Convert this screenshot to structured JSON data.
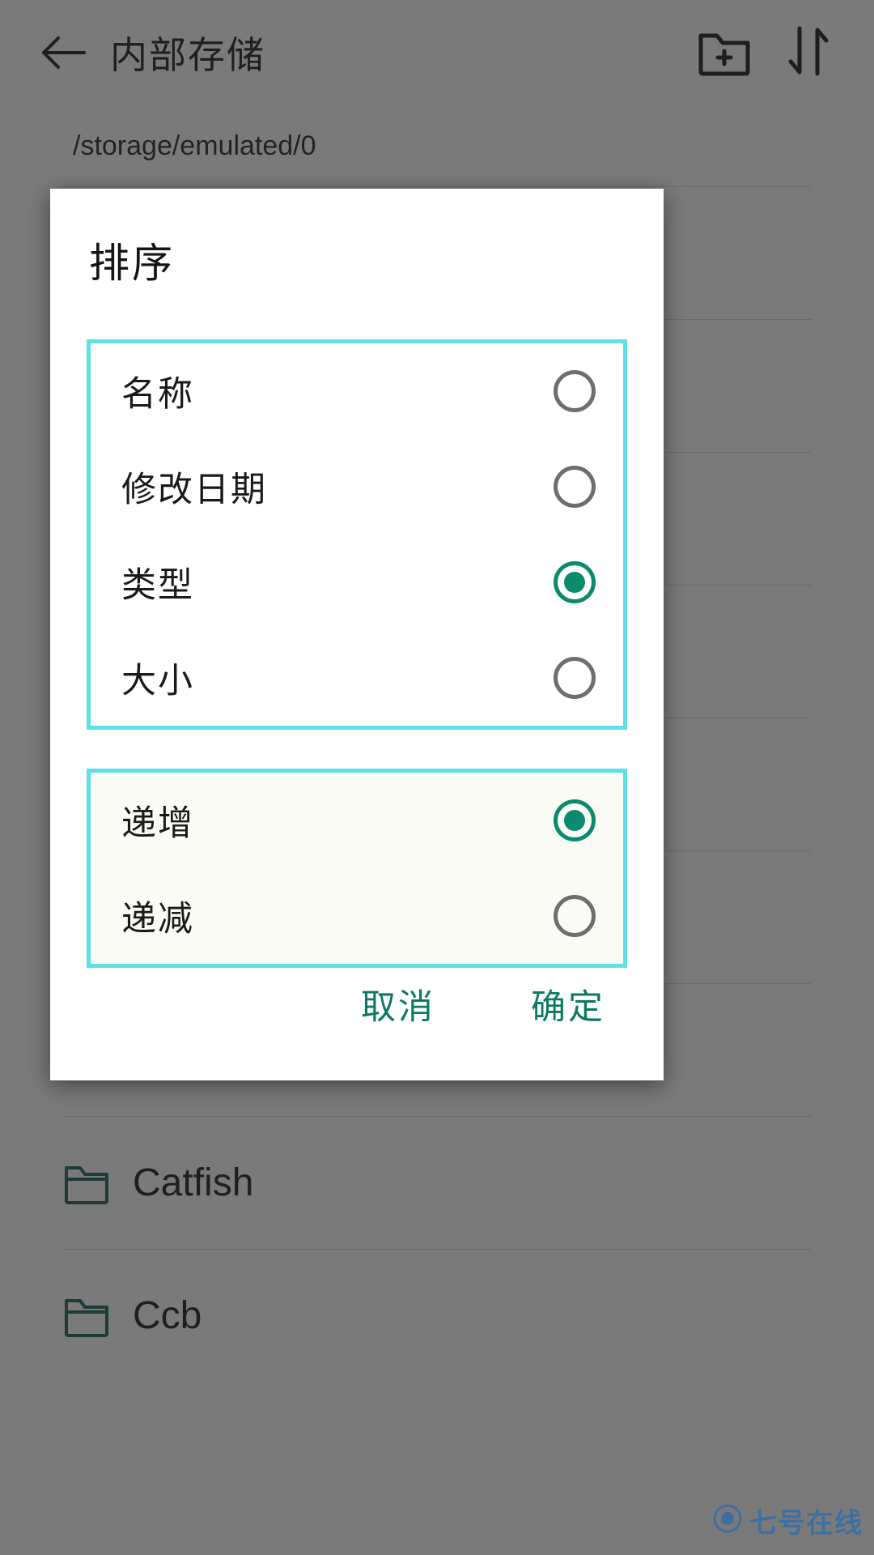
{
  "colors": {
    "accent_teal": "#0c8a6e",
    "highlight_cyan": "#5ce1e6",
    "button_text": "#0c7a62",
    "scrim": "rgba(40,40,40,0.62)",
    "group_order_bg": "#fbfbf5",
    "watermark_blue": "#3b6ea5"
  },
  "appbar": {
    "back_icon": "back-arrow-icon",
    "title": "内部存储",
    "actions": [
      {
        "icon": "new-folder-icon",
        "name": "new-folder-button"
      },
      {
        "icon": "sort-icon",
        "name": "sort-button"
      }
    ]
  },
  "pathbar": {
    "path": "/storage/emulated/0"
  },
  "file_list": {
    "rows": [
      {
        "icon": "folder-icon",
        "name": "Catfish"
      },
      {
        "icon": "folder-icon",
        "name": "Ccb"
      }
    ]
  },
  "dialog": {
    "title": "排序",
    "field_group": {
      "options": [
        {
          "label": "名称",
          "checked": false
        },
        {
          "label": "修改日期",
          "checked": false
        },
        {
          "label": "类型",
          "checked": true
        },
        {
          "label": "大小",
          "checked": false
        }
      ]
    },
    "order_group": {
      "options": [
        {
          "label": "递增",
          "checked": true
        },
        {
          "label": "递减",
          "checked": false
        }
      ]
    },
    "cancel_label": "取消",
    "confirm_label": "确定"
  },
  "watermark": {
    "text": "七号在线",
    "icon": "circle-logo-icon"
  }
}
